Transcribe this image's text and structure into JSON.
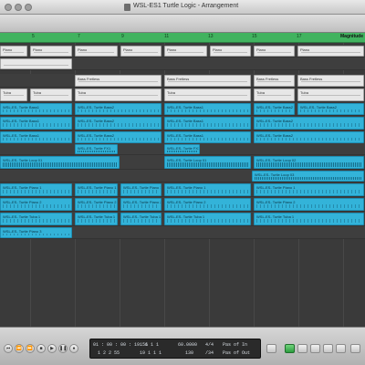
{
  "window": {
    "title": "WSL-ES1 Turtle Logic - Arrangement"
  },
  "ruler": {
    "marks": [
      "5",
      "7",
      "9",
      "11",
      "13",
      "15",
      "17"
    ],
    "label": "Magnitude"
  },
  "tracks": [
    {
      "regions": [
        {
          "label": "Piano",
          "kind": "grey"
        },
        {
          "label": "Piano",
          "kind": "grey"
        },
        {
          "label": "Piano",
          "kind": "grey"
        },
        {
          "label": "Piano",
          "kind": "grey"
        },
        {
          "label": "Piano",
          "kind": "grey"
        },
        {
          "label": "Piano",
          "kind": "grey"
        },
        {
          "label": "Piano",
          "kind": "grey"
        },
        {
          "label": "Piano",
          "kind": "grey"
        }
      ]
    },
    {
      "regions": [
        {
          "label": "",
          "kind": "grey"
        }
      ]
    },
    {
      "regions": [
        {
          "label": "Bass Fretless",
          "kind": "grey"
        },
        {
          "label": "Bass Fretless",
          "kind": "grey"
        },
        {
          "label": "Bass Fretless",
          "kind": "grey"
        },
        {
          "label": "Bass Fretless",
          "kind": "grey"
        }
      ]
    },
    {
      "regions": [
        {
          "label": "Tuba",
          "kind": "grey"
        },
        {
          "label": "Tuba",
          "kind": "grey"
        },
        {
          "label": "Tuba",
          "kind": "grey"
        },
        {
          "label": "Tuba",
          "kind": "grey"
        },
        {
          "label": "Tuba",
          "kind": "grey"
        },
        {
          "label": "Tuba",
          "kind": "grey"
        }
      ]
    },
    {
      "regions": [
        {
          "label": "WSL-ES- Turtle Bass1",
          "kind": "blue"
        },
        {
          "label": "WSL-ES- Turtle Bass2",
          "kind": "blue"
        },
        {
          "label": "WSL-ES- Turtle Bass1",
          "kind": "blue"
        },
        {
          "label": "WSL-ES- Turtle Bass2",
          "kind": "blue"
        },
        {
          "label": "WSL-ES- Turtle Bass2",
          "kind": "blue"
        }
      ]
    },
    {
      "regions": [
        {
          "label": "WSL-ES- Turtle Bass1",
          "kind": "blue"
        },
        {
          "label": "WSL-ES- Turtle Bass2",
          "kind": "blue"
        },
        {
          "label": "WSL-ES- Turtle Bass1",
          "kind": "blue"
        },
        {
          "label": "WSL-ES- Turtle Bass2",
          "kind": "blue"
        }
      ]
    },
    {
      "regions": [
        {
          "label": "WSL-ES- Turtle Bass1",
          "kind": "blue"
        },
        {
          "label": "WSL-ES- Turtle Bass2",
          "kind": "blue"
        },
        {
          "label": "WSL-ES- Turtle Bass1",
          "kind": "blue"
        },
        {
          "label": "WSL-ES- Turtle Bass2",
          "kind": "blue"
        }
      ]
    },
    {
      "regions": [
        {
          "label": "WSL-ES- Turtle FX1",
          "kind": "blue"
        },
        {
          "label": "WSL-ES- Turtle FX1",
          "kind": "blue"
        }
      ]
    },
    {
      "regions": [
        {
          "label": "WSL-ES- Turtle Loop 01",
          "kind": "blue"
        },
        {
          "label": "WSL-ES- Turtle Loop 01",
          "kind": "blue"
        },
        {
          "label": "WSL-ES- Turtle Loop 02",
          "kind": "blue"
        }
      ]
    },
    {
      "regions": [
        {
          "label": "WSL-ES- Turtle Loop 03",
          "kind": "blue"
        }
      ]
    },
    {
      "regions": [
        {
          "label": "WSL-ES- Turtle Piano 1",
          "kind": "blue"
        },
        {
          "label": "WSL-ES- Turtle Piano 1",
          "kind": "blue"
        },
        {
          "label": "WSL-ES- Turtle Piano 1",
          "kind": "blue"
        },
        {
          "label": "WSL-ES- Turtle Piano 1",
          "kind": "blue"
        },
        {
          "label": "WSL-ES- Turtle Piano 1",
          "kind": "blue"
        }
      ]
    },
    {
      "regions": [
        {
          "label": "WSL-ES- Turtle Piano 2",
          "kind": "blue"
        },
        {
          "label": "WSL-ES- Turtle Piano 2",
          "kind": "blue"
        },
        {
          "label": "WSL-ES- Turtle Piano 2",
          "kind": "blue"
        },
        {
          "label": "WSL-ES- Turtle Piano 2",
          "kind": "blue"
        },
        {
          "label": "WSL-ES- Turtle Piano 2",
          "kind": "blue"
        }
      ]
    },
    {
      "regions": [
        {
          "label": "WSL-ES- Turtle Tuba 1",
          "kind": "blue"
        },
        {
          "label": "WSL-ES- Turtle Tuba 1",
          "kind": "blue"
        },
        {
          "label": "WSL-ES- Turtle Tuba 1",
          "kind": "blue"
        },
        {
          "label": "WSL-ES- Turtle Tuba 1",
          "kind": "blue"
        },
        {
          "label": "WSL-ES- Turtle Tuba 1",
          "kind": "blue"
        }
      ]
    },
    {
      "regions": [
        {
          "label": "WSL-ES- Turtle Piano 3",
          "kind": "blue"
        }
      ]
    }
  ],
  "transport": {
    "smpte": "01 : 00 : 00 : 19.56",
    "beats": "1  2  2  55",
    "bar_a": "1  1  1  1",
    "bar_b": "19  1  1  1",
    "tempo": "60.0000",
    "sub": "130",
    "sig_a": "4/4",
    "sig_b": "/34",
    "in": "Pas of In",
    "out": "Pas of Out"
  },
  "colors": {
    "region_blue": "#33b3d9",
    "ruler_green": "#41b35f",
    "lcd": "#2a2a2a"
  }
}
